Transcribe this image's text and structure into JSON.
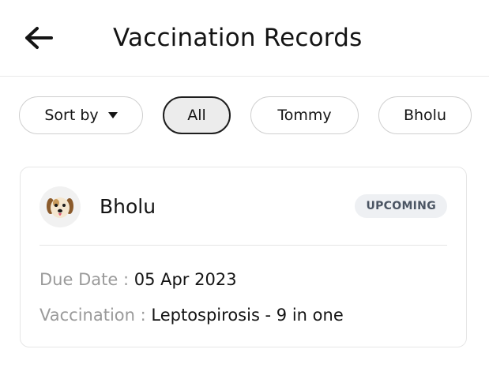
{
  "header": {
    "title": "Vaccination Records",
    "back_icon": "arrow-left-icon"
  },
  "filters": {
    "sort_label": "Sort by",
    "chips": [
      {
        "label": "All",
        "active": true
      },
      {
        "label": "Tommy",
        "active": false
      },
      {
        "label": "Bholu",
        "active": false
      }
    ]
  },
  "records": [
    {
      "pet_name": "Bholu",
      "avatar": "dog-face-icon",
      "status": "UPCOMING",
      "due_label": "Due Date : ",
      "due_value": "05 Apr 2023",
      "vaccination_label": "Vaccination : ",
      "vaccination_value": "Leptospirosis - 9 in one"
    }
  ],
  "colors": {
    "text": "#141414",
    "muted": "#9a9a9a",
    "border": "#e6e6e6",
    "badge_bg": "#eef0f3",
    "badge_text": "#4b5563"
  }
}
